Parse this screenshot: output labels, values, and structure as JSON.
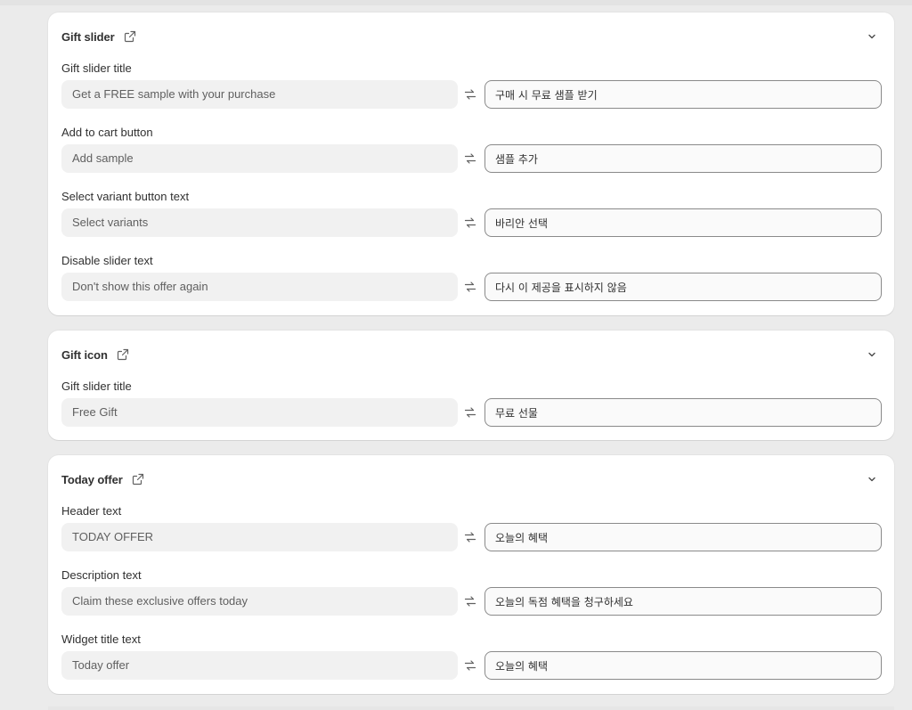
{
  "cards": [
    {
      "title": "Gift slider",
      "fields": [
        {
          "label": "Gift slider title",
          "source": "Get a FREE sample with your purchase",
          "value": "구매 시 무료 샘플 받기"
        },
        {
          "label": "Add to cart button",
          "source": "Add sample",
          "value": "샘플 추가"
        },
        {
          "label": "Select variant button text",
          "source": "Select variants",
          "value": "바리안 선택"
        },
        {
          "label": "Disable slider text",
          "source": "Don't show this offer again",
          "value": "다시 이 제공을 표시하지 않음"
        }
      ]
    },
    {
      "title": "Gift icon",
      "fields": [
        {
          "label": "Gift slider title",
          "source": "Free Gift",
          "value": "무료 선물"
        }
      ]
    },
    {
      "title": "Today offer",
      "fields": [
        {
          "label": "Header text",
          "source": "TODAY OFFER",
          "value": "오늘의 혜택"
        },
        {
          "label": "Description text",
          "source": "Claim these exclusive offers today",
          "value": "오늘의 독점 혜택을 청구하세요"
        },
        {
          "label": "Widget title text",
          "source": "Today offer",
          "value": "오늘의 혜택"
        }
      ]
    }
  ],
  "icons": {
    "external": "external-link-icon",
    "collapse": "chevron-down-icon",
    "swap": "swap-arrows-icon"
  },
  "colors": {
    "background": "#ebebeb",
    "card": "#ffffff",
    "source_field": "#f1f1f1",
    "input_border": "#8a8a8a",
    "text": "#303030"
  }
}
